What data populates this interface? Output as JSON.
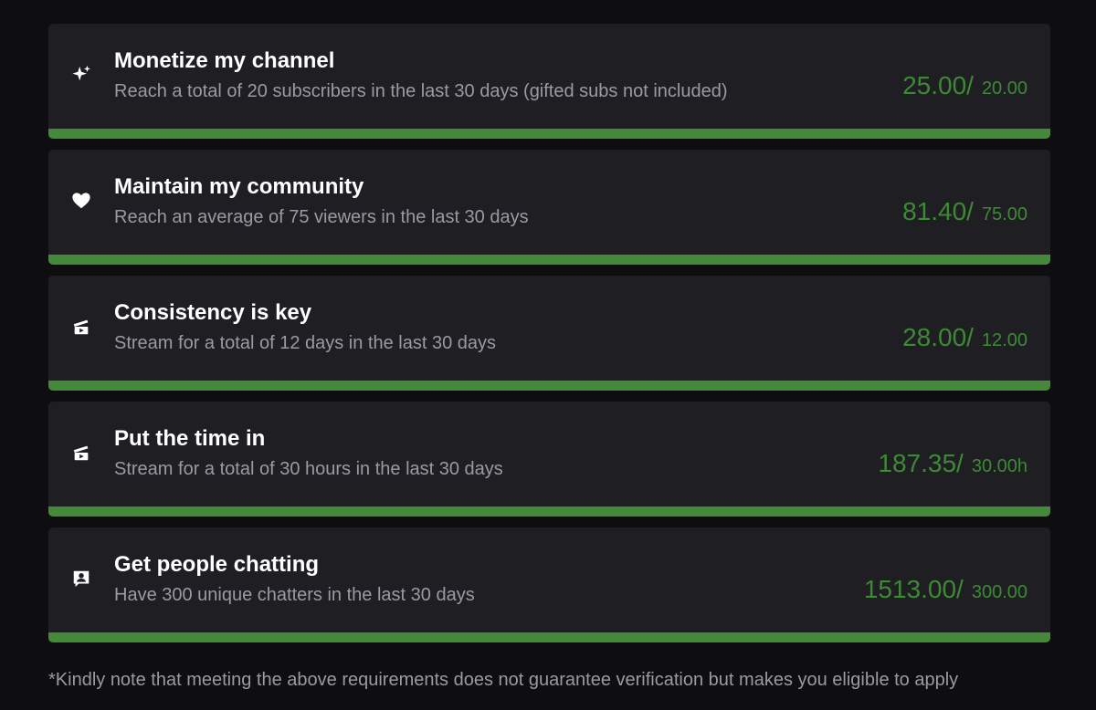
{
  "requirements": [
    {
      "icon": "sparkle-icon",
      "title": "Monetize my channel",
      "description": "Reach a total of 20 subscribers in the last 30 days (gifted subs not included)",
      "current": "25.00/",
      "target": "20.00",
      "progress": 1.0
    },
    {
      "icon": "heart-icon",
      "title": "Maintain my community",
      "description": "Reach an average of 75 viewers in the last 30 days",
      "current": "81.40/",
      "target": "75.00",
      "progress": 1.0
    },
    {
      "icon": "clapperboard-icon",
      "title": "Consistency is key",
      "description": "Stream for a total of 12 days in the last 30 days",
      "current": "28.00/",
      "target": "12.00",
      "progress": 1.0
    },
    {
      "icon": "clapperboard-icon",
      "title": "Put the time in",
      "description": "Stream for a total of 30 hours in the last 30 days",
      "current": "187.35/",
      "target": "30.00h",
      "progress": 1.0
    },
    {
      "icon": "chat-user-icon",
      "title": "Get people chatting",
      "description": "Have 300 unique chatters in the last 30 days",
      "current": "1513.00/",
      "target": "300.00",
      "progress": 1.0
    }
  ],
  "note": "*Kindly note that meeting the above requirements does not guarantee verification but makes you eligible to apply",
  "colors": {
    "background": "#0e0e10",
    "card": "#1f1f23",
    "accent_green": "#448a3a",
    "value_green": "#3d8a35",
    "muted_text": "#9a9aa2"
  }
}
